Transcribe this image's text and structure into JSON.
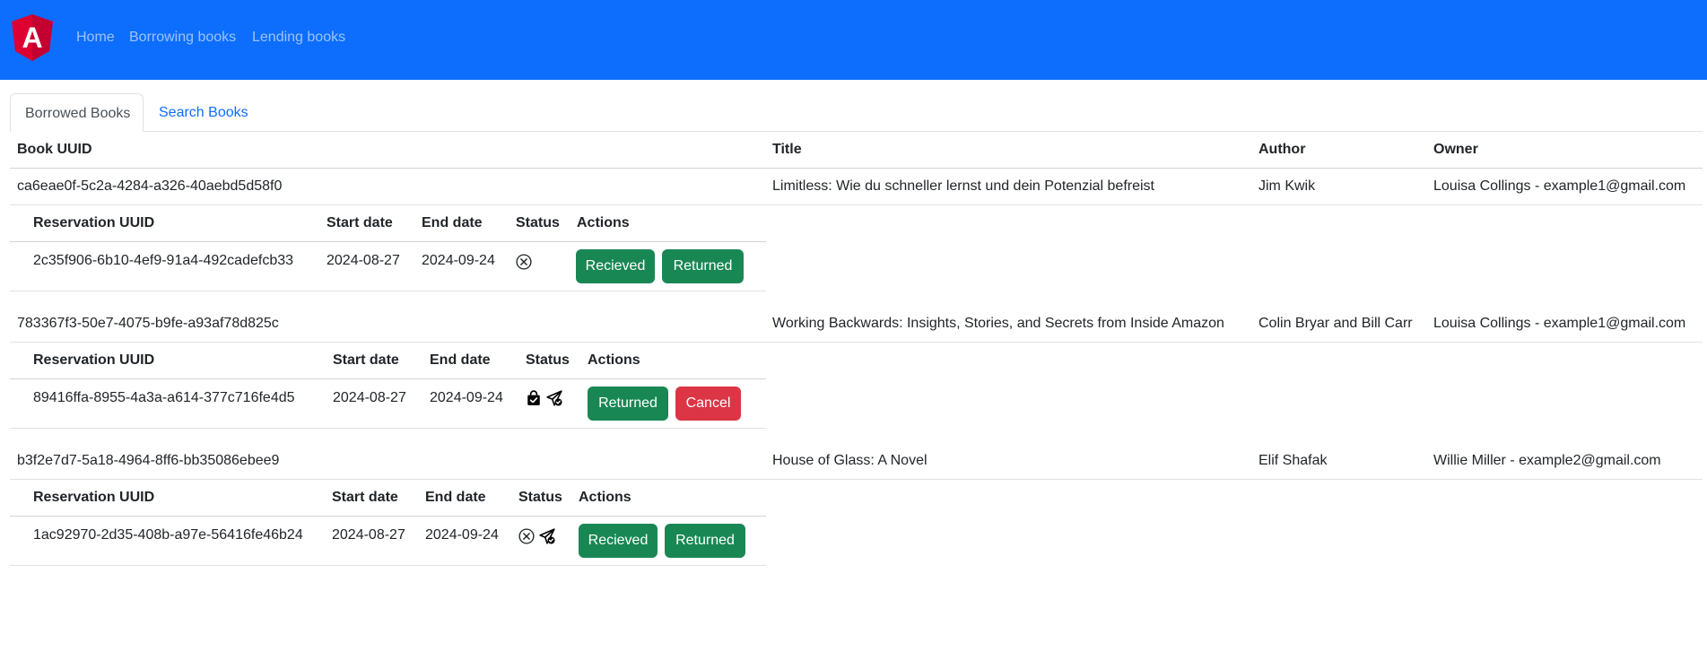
{
  "navbar": {
    "logo_letter": "A",
    "links": [
      "Home",
      "Borrowing books",
      "Lending books"
    ]
  },
  "tabs": [
    "Borrowed Books",
    "Search Books"
  ],
  "table": {
    "headers": [
      "Book UUID",
      "Title",
      "Author",
      "Owner"
    ],
    "sub_headers": [
      "Reservation UUID",
      "Start date",
      "End date",
      "Status",
      "Actions"
    ],
    "books": [
      {
        "uuid": "ca6eae0f-5c2a-4284-a326-40aebd5d58f0",
        "title": "Limitless: Wie du schneller lernst und dein Potenzial befreist",
        "author": "Jim Kwik",
        "owner": "Louisa Collings - example1@gmail.com",
        "reservation": {
          "uuid": "2c35f906-6b10-4ef9-91a4-492cadefcb33",
          "start": "2024-08-27",
          "end": "2024-09-24",
          "status_icons": [
            "x-circle-icon"
          ],
          "actions": [
            "Recieved",
            "Returned"
          ]
        }
      },
      {
        "uuid": "783367f3-50e7-4075-b9fe-a93af78d825c",
        "title": "Working Backwards: Insights, Stories, and Secrets from Inside Amazon",
        "author": "Colin Bryar and Bill Carr",
        "owner": "Louisa Collings - example1@gmail.com",
        "reservation": {
          "uuid": "89416ffa-8955-4a3a-a614-377c716fe4d5",
          "start": "2024-08-27",
          "end": "2024-09-24",
          "status_icons": [
            "bag-check-icon",
            "send-check-icon"
          ],
          "actions": [
            "Returned",
            "Cancel"
          ]
        }
      },
      {
        "uuid": "b3f2e7d7-5a18-4964-8ff6-bb35086ebee9",
        "title": "House of Glass: A Novel",
        "author": "Elif Shafak",
        "owner": "Willie Miller - example2@gmail.com",
        "reservation": {
          "uuid": "1ac92970-2d35-408b-a97e-56416fe46b24",
          "start": "2024-08-27",
          "end": "2024-09-24",
          "status_icons": [
            "x-circle-icon",
            "send-check-icon"
          ],
          "actions": [
            "Recieved",
            "Returned"
          ]
        }
      }
    ]
  },
  "colors": {
    "navbar": "#0d6efd",
    "success": "#198754",
    "danger": "#dc3545",
    "link": "#0d6efd"
  }
}
